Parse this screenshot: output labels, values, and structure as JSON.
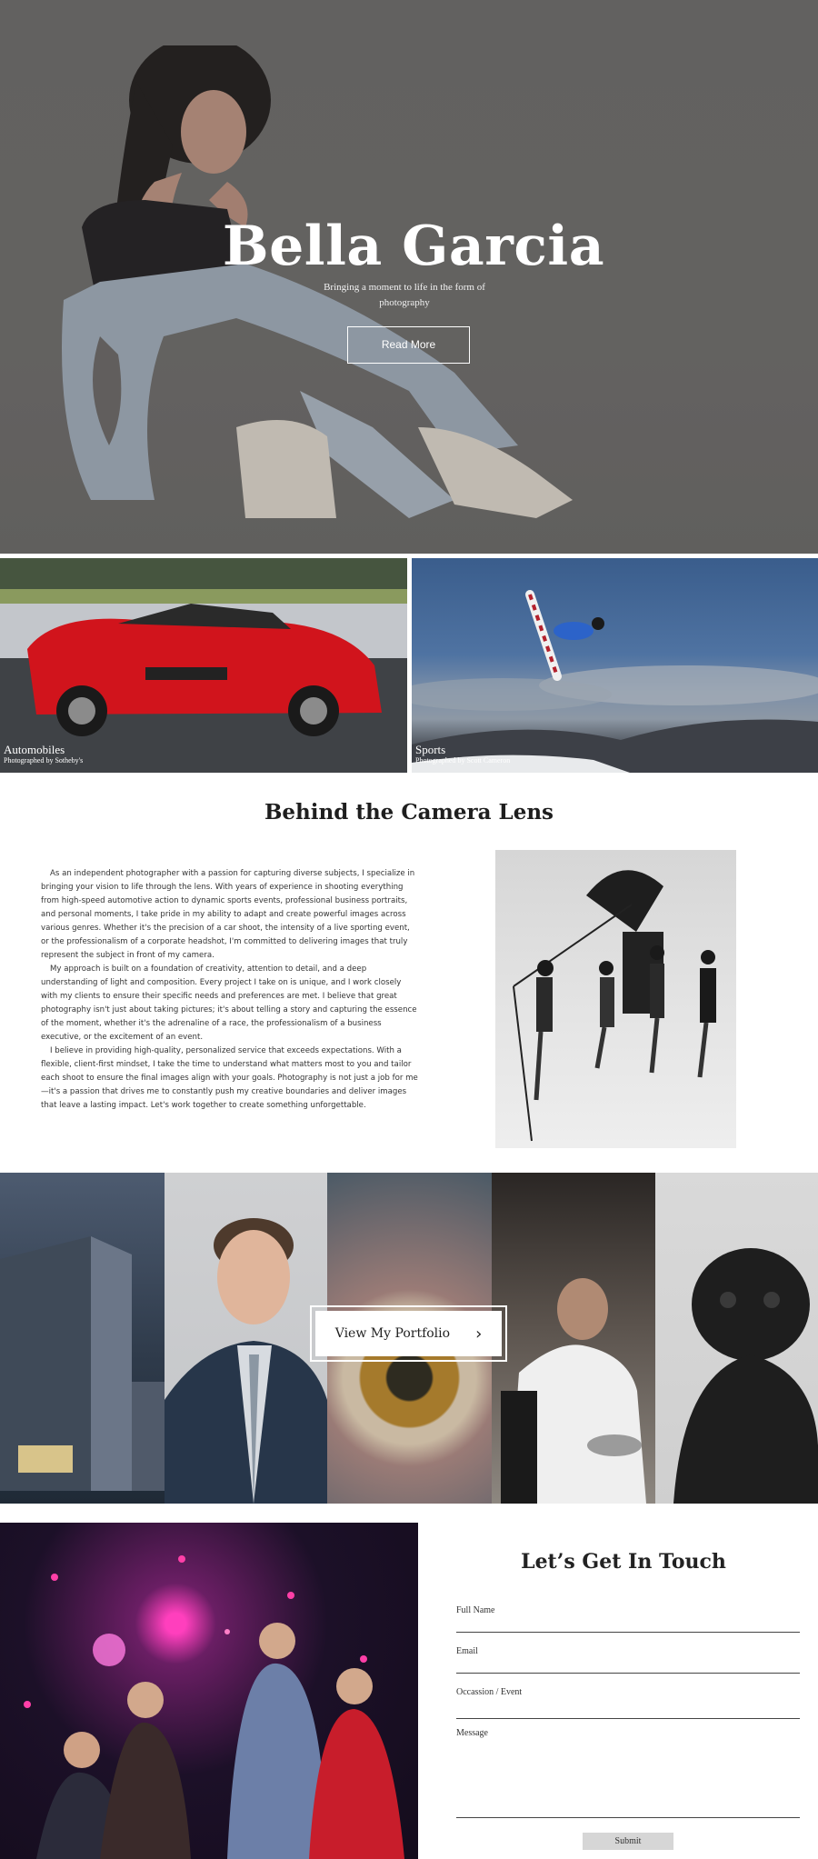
{
  "hero": {
    "title": "Bella Garcia",
    "subtitle": "Bringing a moment to life in the form of photography",
    "button_label": "Read More"
  },
  "gallery": [
    {
      "title": "Automobiles",
      "credit": "Photographed by Sotheby's"
    },
    {
      "title": "Sports",
      "credit": "Photographed by Scott Cameron"
    }
  ],
  "about": {
    "title": "Behind the Camera Lens",
    "paragraphs": [
      "As an independent photographer with a passion for capturing diverse subjects, I specialize in bringing your vision to life through the lens. With years of experience in shooting everything from high-speed automotive action to dynamic sports events, professional business portraits, and personal moments, I take pride in my ability to adapt and create powerful images across various genres. Whether it's the precision of a car shoot, the intensity of a live sporting event, or the professionalism of a corporate headshot, I'm committed to delivering images that truly represent the subject in front of my camera.",
      "My approach is built on a foundation of creativity, attention to detail, and a deep understanding of light and composition. Every project I take on is unique, and I work closely with my clients to ensure their specific needs and preferences are met. I believe that great photography isn't just about taking pictures; it's about telling a story and capturing the essence of the moment, whether it's the adrenaline of a race, the professionalism of a business executive, or the excitement of an event.",
      "I believe in providing high-quality, personalized service that exceeds expectations. With a flexible, client-first mindset, I take the time to understand what matters most to you and tailor each shoot to ensure the final images align with your goals. Photography is not just a job for me—it's a passion that drives me to constantly push my creative boundaries and deliver images that leave a lasting impact. Let's work together to create something unforgettable."
    ]
  },
  "portfolio": {
    "button_label": "View My Portfolio",
    "button_icon": "chevron-right-icon"
  },
  "contact": {
    "title": "Let’s Get In Touch",
    "fields": {
      "full_name": "Full Name",
      "email": "Email",
      "occasion": "Occassion / Event",
      "message": "Message"
    },
    "submit_label": "Submit"
  }
}
